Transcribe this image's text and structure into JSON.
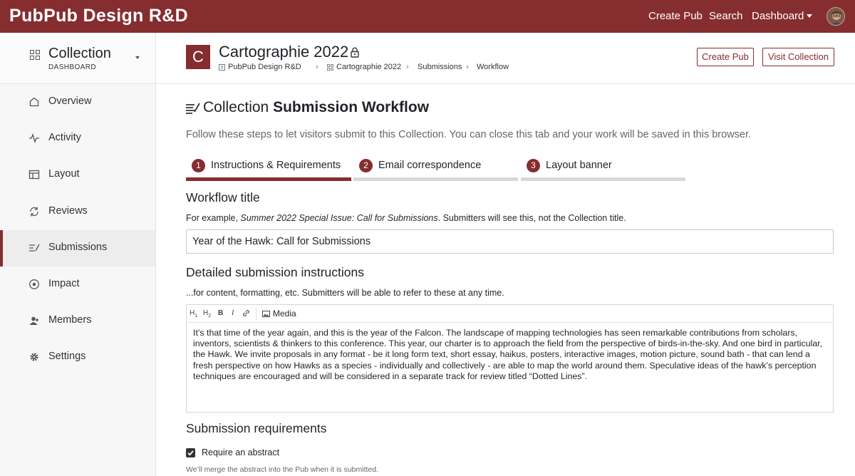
{
  "topbar": {
    "brand": "PubPub Design R&D",
    "create_pub": "Create Pub",
    "search": "Search",
    "dashboard": "Dashboard"
  },
  "sidebar": {
    "collection_title": "Collection",
    "collection_subtitle": "DASHBOARD",
    "items": [
      {
        "label": "Overview",
        "icon": "home-icon"
      },
      {
        "label": "Activity",
        "icon": "activity-icon"
      },
      {
        "label": "Layout",
        "icon": "layout-icon"
      },
      {
        "label": "Reviews",
        "icon": "reviews-icon"
      },
      {
        "label": "Submissions",
        "icon": "submissions-icon",
        "active": true
      },
      {
        "label": "Impact",
        "icon": "impact-icon"
      },
      {
        "label": "Members",
        "icon": "members-icon"
      },
      {
        "label": "Settings",
        "icon": "gear-icon"
      }
    ]
  },
  "header": {
    "logo_letter": "C",
    "title": "Cartographie 2022",
    "breadcrumbs": [
      "PubPub Design R&D",
      "Cartographie 2022",
      "Submissions",
      "Workflow"
    ],
    "create_pub": "Create Pub",
    "visit_collection": "Visit Collection"
  },
  "workflow": {
    "title_prefix": "Collection",
    "title_bold": "Submission Workflow",
    "description": "Follow these steps to let visitors submit to this Collection. You can close this tab and your work will be saved in this browser.",
    "steps": [
      {
        "num": "1",
        "label": "Instructions & Requirements",
        "active": true
      },
      {
        "num": "2",
        "label": "Email correspondence",
        "active": false
      },
      {
        "num": "3",
        "label": "Layout banner",
        "active": false
      }
    ]
  },
  "form": {
    "workflow_title_heading": "Workflow title",
    "workflow_title_hint_prefix": "For example, ",
    "workflow_title_hint_example": "Summer 2022 Special Issue: Call for Submissions",
    "workflow_title_hint_suffix": ". Submitters will see this, not the Collection title.",
    "workflow_title_value": "Year of the Hawk: Call for Submissions",
    "instructions_heading": "Detailed submission instructions",
    "instructions_hint": "...for content, formatting, etc. Submitters will be able to refer to these at any time.",
    "toolbar": {
      "h1": "H",
      "h1_sub": "1",
      "h2": "H",
      "h2_sub": "2",
      "bold": "B",
      "italic": "I",
      "media": "Media"
    },
    "instructions_lines": [
      "It’s that time of the year again, and this is the year of the Falcon. The landscape of mapping technologies has seen remarkable contributions from scholars,",
      "inventors, scientists & thinkers to this conference. This year, our charter is to approach the field from the perspective of birds-in-the-sky. And one bird in particular,",
      "the Hawk. We invite proposals in any format - be it long form text, short essay, haikus, posters, interactive images, motion picture, sound bath - that can lend a",
      "fresh perspective on how Hawks as a species - individually and collectively - are able to map the world around them. Speculative ideas of the hawk’s perception",
      "techniques are encouraged and will be considered in a separate track for review titled “Dotted Lines”."
    ],
    "requirements_heading": "Submission requirements",
    "require_abstract_label": "Require an abstract",
    "require_abstract_checked": true,
    "abstract_note": "We’ll merge the abstract into the Pub when it is submitted."
  },
  "colors": {
    "brand": "#862d2f",
    "sidebar_bg": "#f7f7f7"
  }
}
